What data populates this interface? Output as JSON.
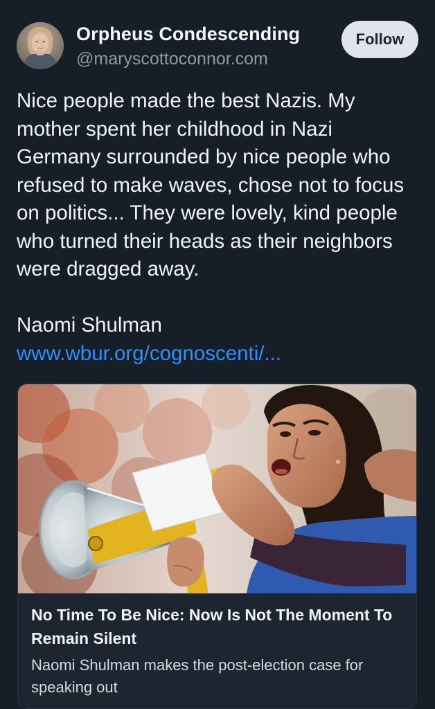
{
  "post": {
    "author": {
      "display_name": "Orpheus Condescending",
      "handle": "@maryscottoconnor.com",
      "avatar_icon": "user-avatar"
    },
    "follow_label": "Follow",
    "text": "Nice people made the best Nazis. My mother spent her childhood in Nazi Germany surrounded by nice people who refused to make waves, chose not to focus on politics... They were lovely, kind people who turned their heads as their neighbors were dragged away.\n\nNaomi Shulman",
    "link_text": "www.wbur.org/cognoscenti/...",
    "link_card": {
      "title": "No Time To Be Nice: Now Is Not The Moment To Remain Silent",
      "description": "Naomi Shulman makes the post-election case for speaking out"
    }
  },
  "colors": {
    "background": "#161e27",
    "link": "#2f8fff",
    "follow_button_bg": "#dfe5eb",
    "handle": "#8d9aa8"
  }
}
